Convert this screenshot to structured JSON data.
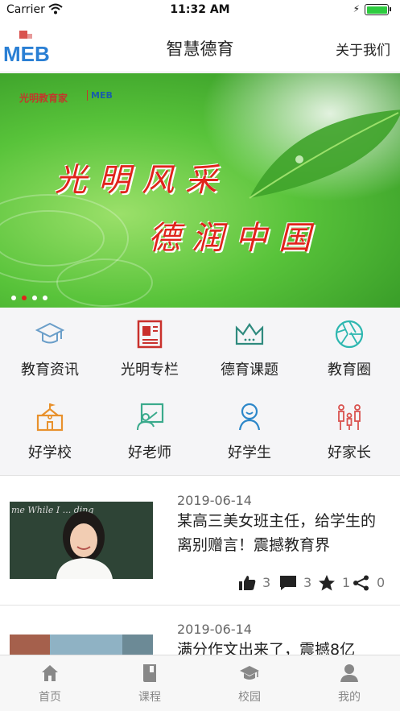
{
  "status_bar": {
    "carrier": "Carrier",
    "time": "11:32 AM"
  },
  "nav": {
    "title": "智慧德育",
    "about_label": "关于我们",
    "logo_text": "MEB"
  },
  "banner": {
    "brand_text": "光明教育家",
    "brand_logo_text": "MEB",
    "line1": "光明风采",
    "line2": "德润中国",
    "active_dot": 1,
    "dot_count": 4
  },
  "categories": [
    {
      "label": "教育资讯",
      "icon": "graduation-cap-icon",
      "color": "#6a9ec9"
    },
    {
      "label": "光明专栏",
      "icon": "newspaper-icon",
      "color": "#c9302c"
    },
    {
      "label": "德育课题",
      "icon": "crown-icon",
      "color": "#2f8a7e"
    },
    {
      "label": "教育圈",
      "icon": "aperture-icon",
      "color": "#2eb7b0"
    },
    {
      "label": "好学校",
      "icon": "school-icon",
      "color": "#e8912d"
    },
    {
      "label": "好老师",
      "icon": "teacher-icon",
      "color": "#3aaa8c"
    },
    {
      "label": "好学生",
      "icon": "student-icon",
      "color": "#2d87c9"
    },
    {
      "label": "好家长",
      "icon": "family-icon",
      "color": "#d9534f"
    }
  ],
  "articles": [
    {
      "date": "2019-06-14",
      "title": "某高三美女班主任，给学生的离别赠言！震撼教育界",
      "likes": "3",
      "comments": "3",
      "favorites": "1",
      "shares": "0",
      "thumb_chalk_text": "me While I ... ding"
    },
    {
      "date": "2019-06-14",
      "title": "满分作文出来了，震撼8亿",
      "likes": "",
      "comments": "",
      "favorites": "",
      "shares": ""
    }
  ],
  "tabs": [
    {
      "label": "首页",
      "icon": "home-icon",
      "active": true
    },
    {
      "label": "课程",
      "icon": "book-icon",
      "active": false
    },
    {
      "label": "校园",
      "icon": "mortarboard-icon",
      "active": false
    },
    {
      "label": "我的",
      "icon": "user-icon",
      "active": false
    }
  ],
  "colors": {
    "accent_red": "#e0231b",
    "tab_inactive": "#888888",
    "text": "#222222"
  }
}
